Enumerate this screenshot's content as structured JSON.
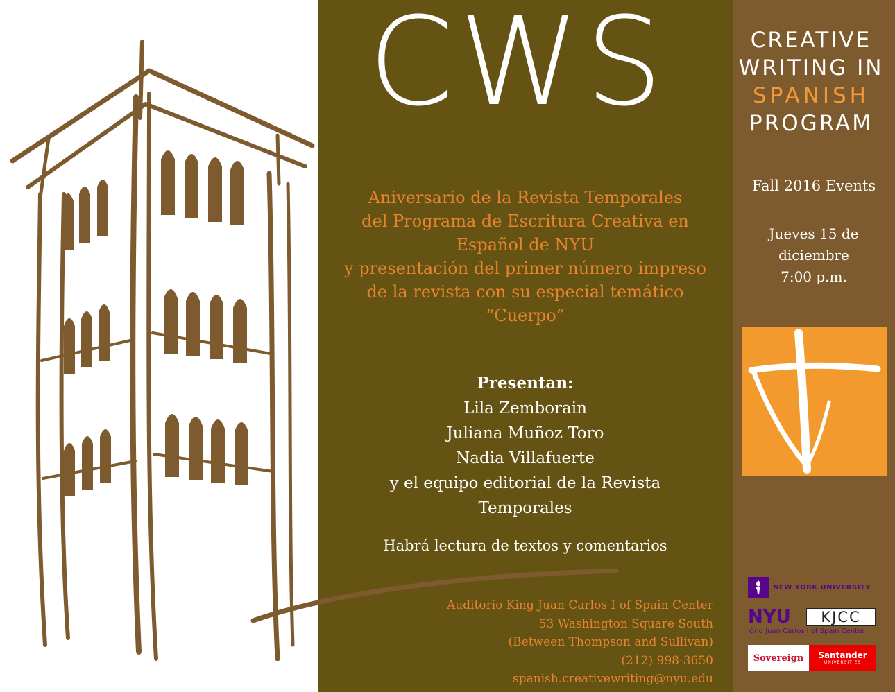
{
  "logo": {
    "text": "CWS"
  },
  "program": {
    "line1": "CREATIVE",
    "line2": "WRITING IN",
    "line3": "SPANISH",
    "line4": "PROGRAM"
  },
  "events_label": "Fall 2016 Events",
  "event_date": {
    "line1": "Jueves 15 de",
    "line2": "diciembre",
    "line3": "7:00 p.m."
  },
  "headline": [
    "Aniversario de la Revista Temporales",
    "del Programa de Escritura Creativa en",
    "Español de NYU",
    "y presentación del primer número impreso",
    "de la revista con su especial temático",
    "“Cuerpo”"
  ],
  "presenters": {
    "heading": "Presentan:",
    "names": [
      "Lila Zemborain",
      "Juliana Muñoz Toro",
      "Nadia Villafuerte",
      "y el equipo editorial de la Revista",
      "Temporales"
    ]
  },
  "reading_note": "Habrá lectura de textos y comentarios",
  "venue": {
    "line1": "Auditorio King Juan Carlos I of Spain Center",
    "line2": "53 Washington Square South",
    "line3": "(Between Thompson and Sullivan)",
    "phone": "(212) 998-3650",
    "email": "spanish.creativewriting@nyu.edu"
  },
  "sponsors": {
    "nyu_small": "NEW YORK UNIVERSITY",
    "nyu_big": "NYU",
    "kjcc": "KJCC",
    "kjcc_caption": "King Juan Carlos I of Spain Center",
    "sovereign": "Sovereign",
    "santander": "Santander",
    "santander_sub": "UNIVERSITIES"
  },
  "colors": {
    "olive_panel": "#655314",
    "brown_panel": "#7e5a2f",
    "orange_text": "#e8842f",
    "emblem_orange": "#f39a2f",
    "building_brown": "#7e5a2f",
    "nyu_purple": "#57068c"
  }
}
